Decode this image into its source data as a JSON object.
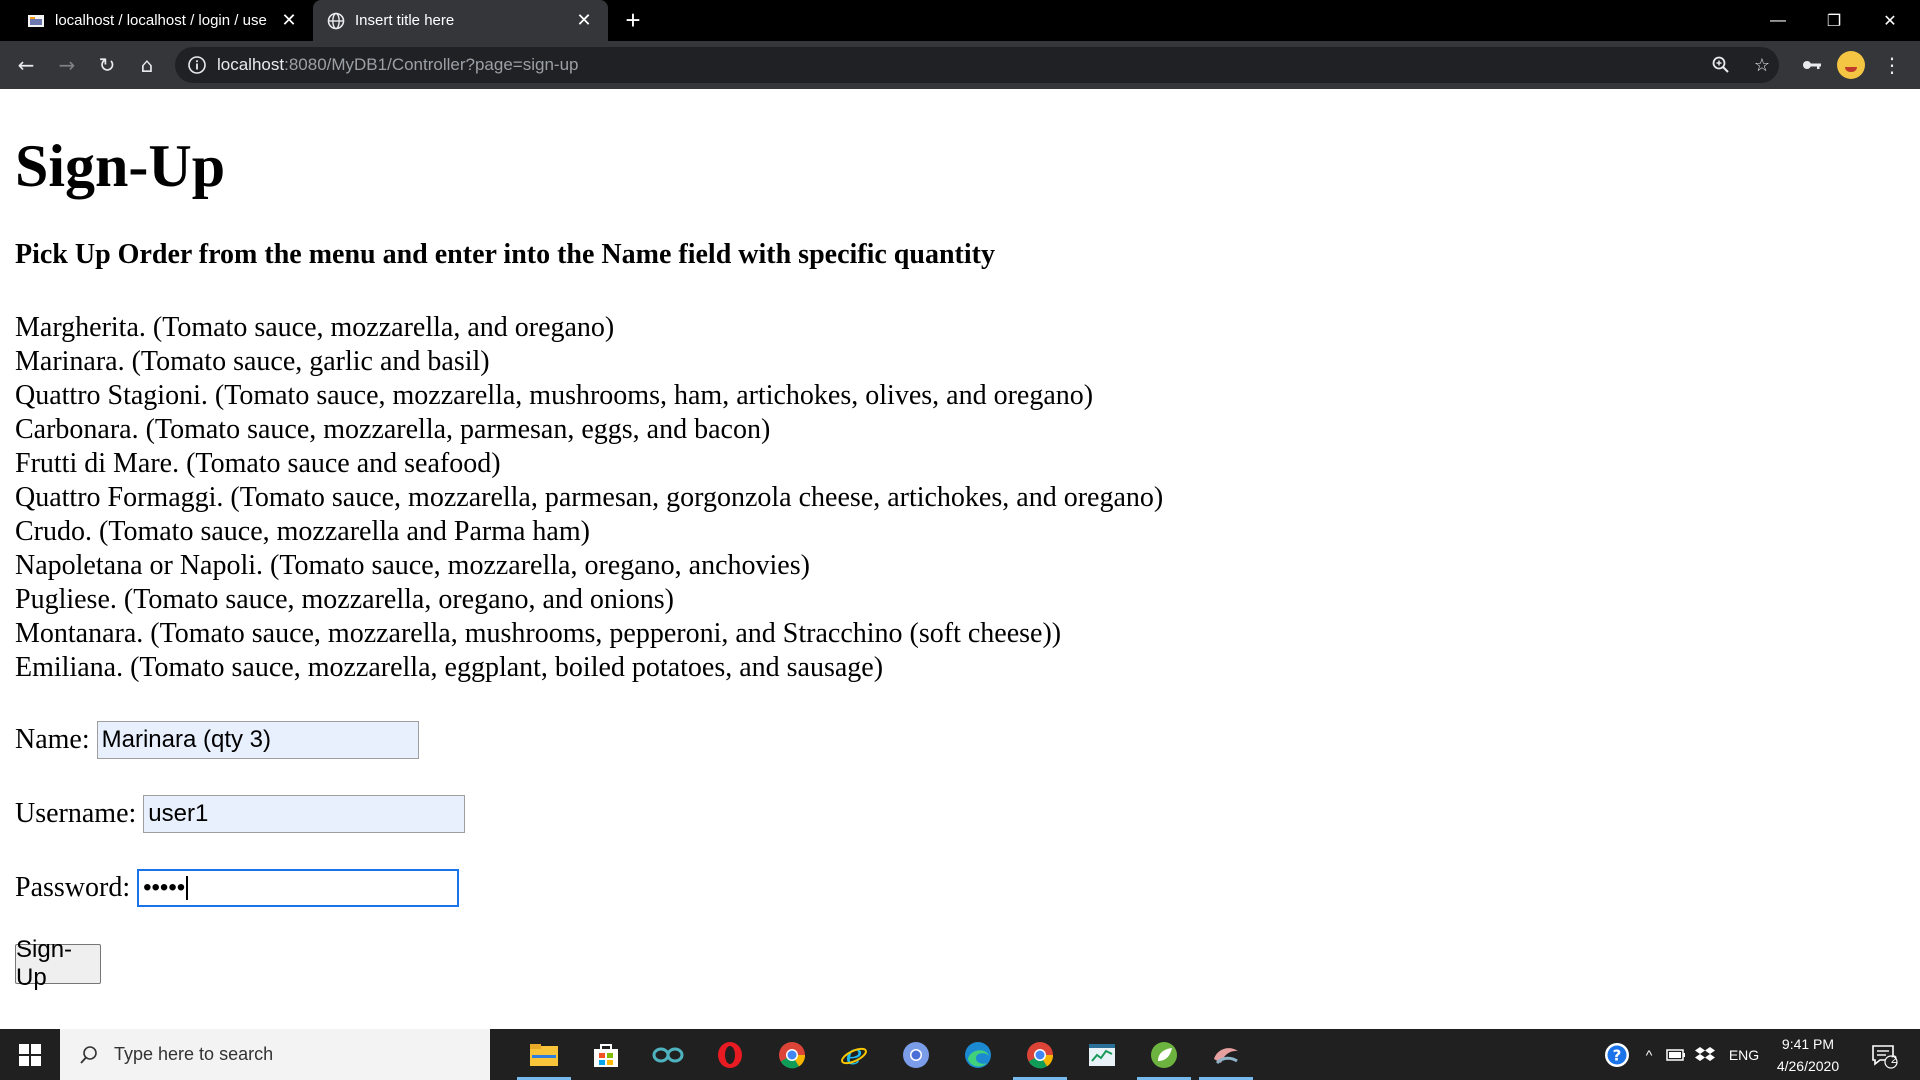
{
  "browser": {
    "tabs": [
      {
        "title": "localhost / localhost / login / use",
        "active": false
      },
      {
        "title": "Insert title here",
        "active": true
      }
    ],
    "new_tab": "+",
    "url": {
      "host": "localhost",
      "path": ":8080/MyDB1/Controller?page=sign-up"
    }
  },
  "page": {
    "heading": "Sign-Up",
    "subheading": "Pick Up Order from the menu and enter into the Name field with specific quantity",
    "menu": [
      "Margherita. (Tomato sauce, mozzarella, and oregano)",
      "Marinara. (Tomato sauce, garlic and basil)",
      "Quattro Stagioni. (Tomato sauce, mozzarella, mushrooms, ham, artichokes, olives, and oregano)",
      "Carbonara. (Tomato sauce, mozzarella, parmesan, eggs, and bacon)",
      "Frutti di Mare. (Tomato sauce and seafood)",
      "Quattro Formaggi. (Tomato sauce, mozzarella, parmesan, gorgonzola cheese, artichokes, and oregano)",
      "Crudo. (Tomato sauce, mozzarella and Parma ham)",
      "Napoletana or Napoli. (Tomato sauce, mozzarella, oregano, anchovies)",
      "Pugliese. (Tomato sauce, mozzarella, oregano, and onions)",
      "Montanara. (Tomato sauce, mozzarella, mushrooms, pepperoni, and Stracchino (soft cheese))",
      "Emiliana. (Tomato sauce, mozzarella, eggplant, boiled potatoes, and sausage)"
    ],
    "form": {
      "name_label": "Name:",
      "name_value": "Marinara (qty 3)",
      "username_label": "Username:",
      "username_value": "user1",
      "password_label": "Password:",
      "password_value": "•••••",
      "submit_label": "Sign-Up"
    }
  },
  "taskbar": {
    "search_placeholder": "Type here to search",
    "language": "ENG",
    "time": "9:41 PM",
    "date": "4/26/2020",
    "notification_count": "2"
  },
  "colors": {
    "tabbar": "#000000",
    "toolbar": "#35363a",
    "omnibox": "#202124",
    "autofill": "#e8f0fe",
    "focus": "#1a73e8",
    "taskbar": "#202020"
  }
}
